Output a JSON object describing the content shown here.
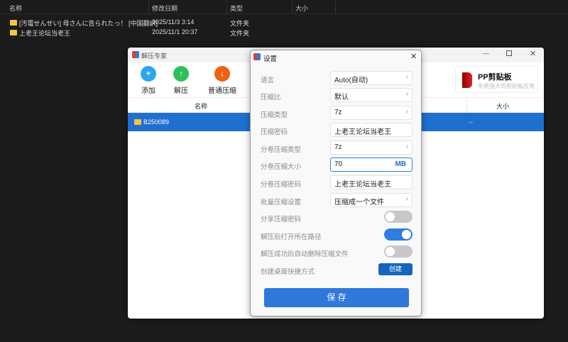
{
  "explorer": {
    "columns": [
      "名称",
      "修改日期",
      "类型",
      "大小"
    ],
    "rows": [
      {
        "name": "[汚電せんせい] 母さんに告られたっ！ [中国翻訳]",
        "date": "2025/11/3 3:14",
        "type": "文件夹"
      },
      {
        "name": "上老王论坛当老王",
        "date": "2025/11/1 20:37",
        "type": "文件夹"
      }
    ]
  },
  "app": {
    "title": "解压专家",
    "toolbar": [
      "添加",
      "解压",
      "普通压缩"
    ],
    "ad_title": "PP剪贴板",
    "ad_sub": "免费强大的剪贴板应用",
    "col_name": "名称",
    "col_size": "大小",
    "file": {
      "name": "B250089",
      "size": "--"
    }
  },
  "dialog": {
    "title": "设置",
    "rows": [
      {
        "label": "语言",
        "value": "Auto(自动)"
      },
      {
        "label": "压缩比",
        "value": "默认"
      },
      {
        "label": "压缩类型",
        "value": "7z"
      },
      {
        "label": "压缩密码",
        "value": "上老王论坛当老王"
      },
      {
        "label": "分卷压缩类型",
        "value": "7z"
      },
      {
        "label": "分卷压缩大小",
        "value": "70",
        "unit": "MB"
      },
      {
        "label": "分卷压缩密码",
        "value": "上老王论坛当老王"
      },
      {
        "label": "批量压缩设置",
        "value": "压缩成一个文件"
      }
    ],
    "toggles": [
      {
        "label": "分享压缩密码",
        "on": false
      },
      {
        "label": "解压后打开所在路径",
        "on": true
      },
      {
        "label": "解压成功后自动删除压缩文件",
        "on": false
      }
    ],
    "shortcut_label": "创建桌面快捷方式",
    "create": "创建",
    "save": "保 存"
  }
}
